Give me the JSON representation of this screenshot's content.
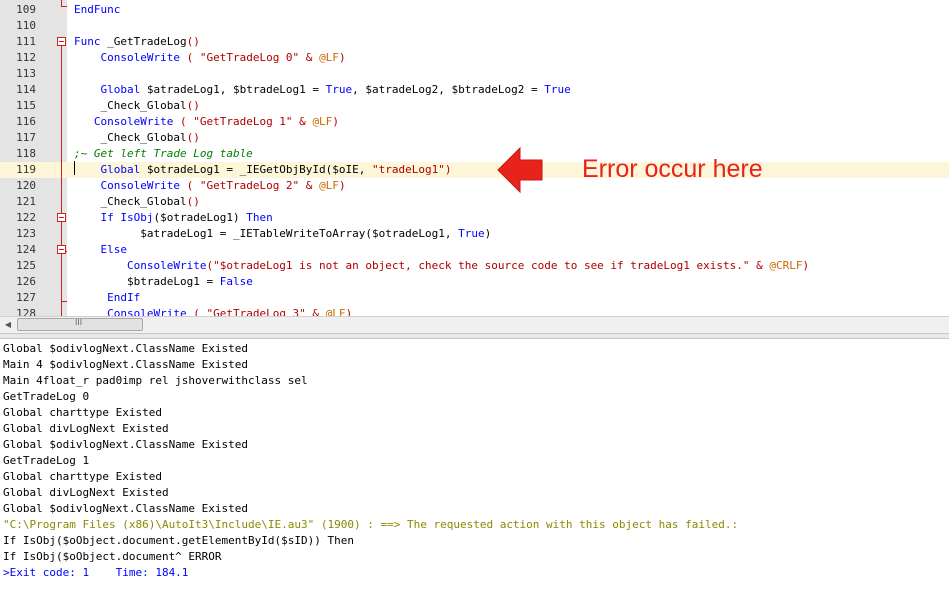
{
  "editor": {
    "lines": [
      {
        "num": "109",
        "segments": [
          {
            "t": "EndFunc",
            "c": "kw"
          }
        ]
      },
      {
        "num": "110",
        "segments": []
      },
      {
        "num": "111",
        "segments": [
          {
            "t": "Func ",
            "c": "kw"
          },
          {
            "t": "_GetTradeLog",
            "c": "vr"
          },
          {
            "t": "()",
            "c": "str"
          }
        ]
      },
      {
        "num": "112",
        "segments": [
          {
            "t": "    ConsoleWrite",
            "c": "fn"
          },
          {
            "t": " ( ",
            "c": "str"
          },
          {
            "t": "\"GetTradeLog 0\"",
            "c": "str"
          },
          {
            "t": " & ",
            "c": "str"
          },
          {
            "t": "@LF",
            "c": "mac"
          },
          {
            "t": ")",
            "c": "str"
          }
        ]
      },
      {
        "num": "113",
        "segments": []
      },
      {
        "num": "114",
        "segments": [
          {
            "t": "    Global ",
            "c": "kw"
          },
          {
            "t": "$atradeLog1, $btradeLog1 = ",
            "c": "vr"
          },
          {
            "t": "True",
            "c": "kw"
          },
          {
            "t": ", $atradeLog2, $btradeLog2 = ",
            "c": "vr"
          },
          {
            "t": "True",
            "c": "kw"
          }
        ]
      },
      {
        "num": "115",
        "segments": [
          {
            "t": "    _Check_Global",
            "c": "vr"
          },
          {
            "t": "()",
            "c": "str"
          }
        ]
      },
      {
        "num": "116",
        "segments": [
          {
            "t": "   ConsoleWrite",
            "c": "fn"
          },
          {
            "t": " ( ",
            "c": "str"
          },
          {
            "t": "\"GetTradeLog 1\"",
            "c": "str"
          },
          {
            "t": " & ",
            "c": "str"
          },
          {
            "t": "@LF",
            "c": "mac"
          },
          {
            "t": ")",
            "c": "str"
          }
        ]
      },
      {
        "num": "117",
        "segments": [
          {
            "t": "    _Check_Global",
            "c": "vr"
          },
          {
            "t": "()",
            "c": "str"
          }
        ]
      },
      {
        "num": "118",
        "segments": [
          {
            "t": ";~ Get left Trade Log table",
            "c": "cm"
          }
        ]
      },
      {
        "num": "119",
        "segments": [
          {
            "t": "    Global ",
            "c": "kw"
          },
          {
            "t": "$otradeLog1 = _IEGetObjById($oIE, ",
            "c": "vr"
          },
          {
            "t": "\"tradeLog1\"",
            "c": "str"
          },
          {
            "t": ")",
            "c": "str"
          }
        ]
      },
      {
        "num": "120",
        "segments": [
          {
            "t": "    ConsoleWrite",
            "c": "fn"
          },
          {
            "t": " ( ",
            "c": "str"
          },
          {
            "t": "\"GetTradeLog 2\"",
            "c": "str"
          },
          {
            "t": " & ",
            "c": "str"
          },
          {
            "t": "@LF",
            "c": "mac"
          },
          {
            "t": ")",
            "c": "str"
          }
        ]
      },
      {
        "num": "121",
        "segments": [
          {
            "t": "    _Check_Global",
            "c": "vr"
          },
          {
            "t": "()",
            "c": "str"
          }
        ]
      },
      {
        "num": "122",
        "segments": [
          {
            "t": "    If ",
            "c": "kw"
          },
          {
            "t": "IsObj",
            "c": "fn"
          },
          {
            "t": "($otradeLog1) ",
            "c": "vr"
          },
          {
            "t": "Then",
            "c": "kw"
          }
        ]
      },
      {
        "num": "123",
        "segments": [
          {
            "t": "          $atradeLog1 = _IETableWriteToArray($otradeLog1, ",
            "c": "vr"
          },
          {
            "t": "True",
            "c": "kw"
          },
          {
            "t": ")",
            "c": "vr"
          }
        ]
      },
      {
        "num": "124",
        "segments": [
          {
            "t": "    Else",
            "c": "kw"
          }
        ]
      },
      {
        "num": "125",
        "segments": [
          {
            "t": "        ConsoleWrite",
            "c": "fn"
          },
          {
            "t": "(",
            "c": "str"
          },
          {
            "t": "\"$otradeLog1 is not an object, check the source code to see if tradeLog1 exists.\"",
            "c": "str"
          },
          {
            "t": " & ",
            "c": "str"
          },
          {
            "t": "@CRLF",
            "c": "mac"
          },
          {
            "t": ")",
            "c": "str"
          }
        ]
      },
      {
        "num": "126",
        "segments": [
          {
            "t": "        $btradeLog1 = ",
            "c": "vr"
          },
          {
            "t": "False",
            "c": "kw"
          }
        ]
      },
      {
        "num": "127",
        "segments": [
          {
            "t": "     EndIf",
            "c": "kw"
          }
        ]
      },
      {
        "num": "128",
        "segments": [
          {
            "t": "     ConsoleWrite",
            "c": "fn"
          },
          {
            "t": " ( ",
            "c": "str"
          },
          {
            "t": "\"GetTradeLog 3\"",
            "c": "str"
          },
          {
            "t": " & ",
            "c": "str"
          },
          {
            "t": "@LF",
            "c": "mac"
          },
          {
            "t": ")",
            "c": "str"
          }
        ]
      }
    ],
    "highlighted_line": "119"
  },
  "annotation": {
    "text": "Error occur here",
    "color": "#e8231c"
  },
  "scrollbar": {
    "left_arrow_icon": "triangle-left-icon",
    "grip": "III"
  },
  "output": {
    "lines": [
      {
        "t": "Global $odivlogNext.ClassName Existed",
        "kind": "normal"
      },
      {
        "t": "Main 4 $odivlogNext.ClassName Existed",
        "kind": "normal"
      },
      {
        "t": "Main 4float_r pad0imp rel jshoverwithclass sel",
        "kind": "normal"
      },
      {
        "t": "GetTradeLog 0",
        "kind": "normal"
      },
      {
        "t": "Global charttype Existed",
        "kind": "normal"
      },
      {
        "t": "Global divLogNext Existed",
        "kind": "normal"
      },
      {
        "t": "Global $odivlogNext.ClassName Existed",
        "kind": "normal"
      },
      {
        "t": "GetTradeLog 1",
        "kind": "normal"
      },
      {
        "t": "Global charttype Existed",
        "kind": "normal"
      },
      {
        "t": "Global divLogNext Existed",
        "kind": "normal"
      },
      {
        "t": "Global $odivlogNext.ClassName Existed",
        "kind": "normal"
      },
      {
        "t": "\"C:\\Program Files (x86)\\AutoIt3\\Include\\IE.au3\" (1900) : ==> The requested action with this object has failed.:",
        "kind": "err"
      },
      {
        "t": "If IsObj($oObject.document.getElementById($sID)) Then",
        "kind": "normal"
      },
      {
        "t": "If IsObj($oObject.document^ ERROR",
        "kind": "normal"
      },
      {
        "t": ">Exit code: 1    Time: 184.1",
        "kind": "exit"
      }
    ]
  }
}
